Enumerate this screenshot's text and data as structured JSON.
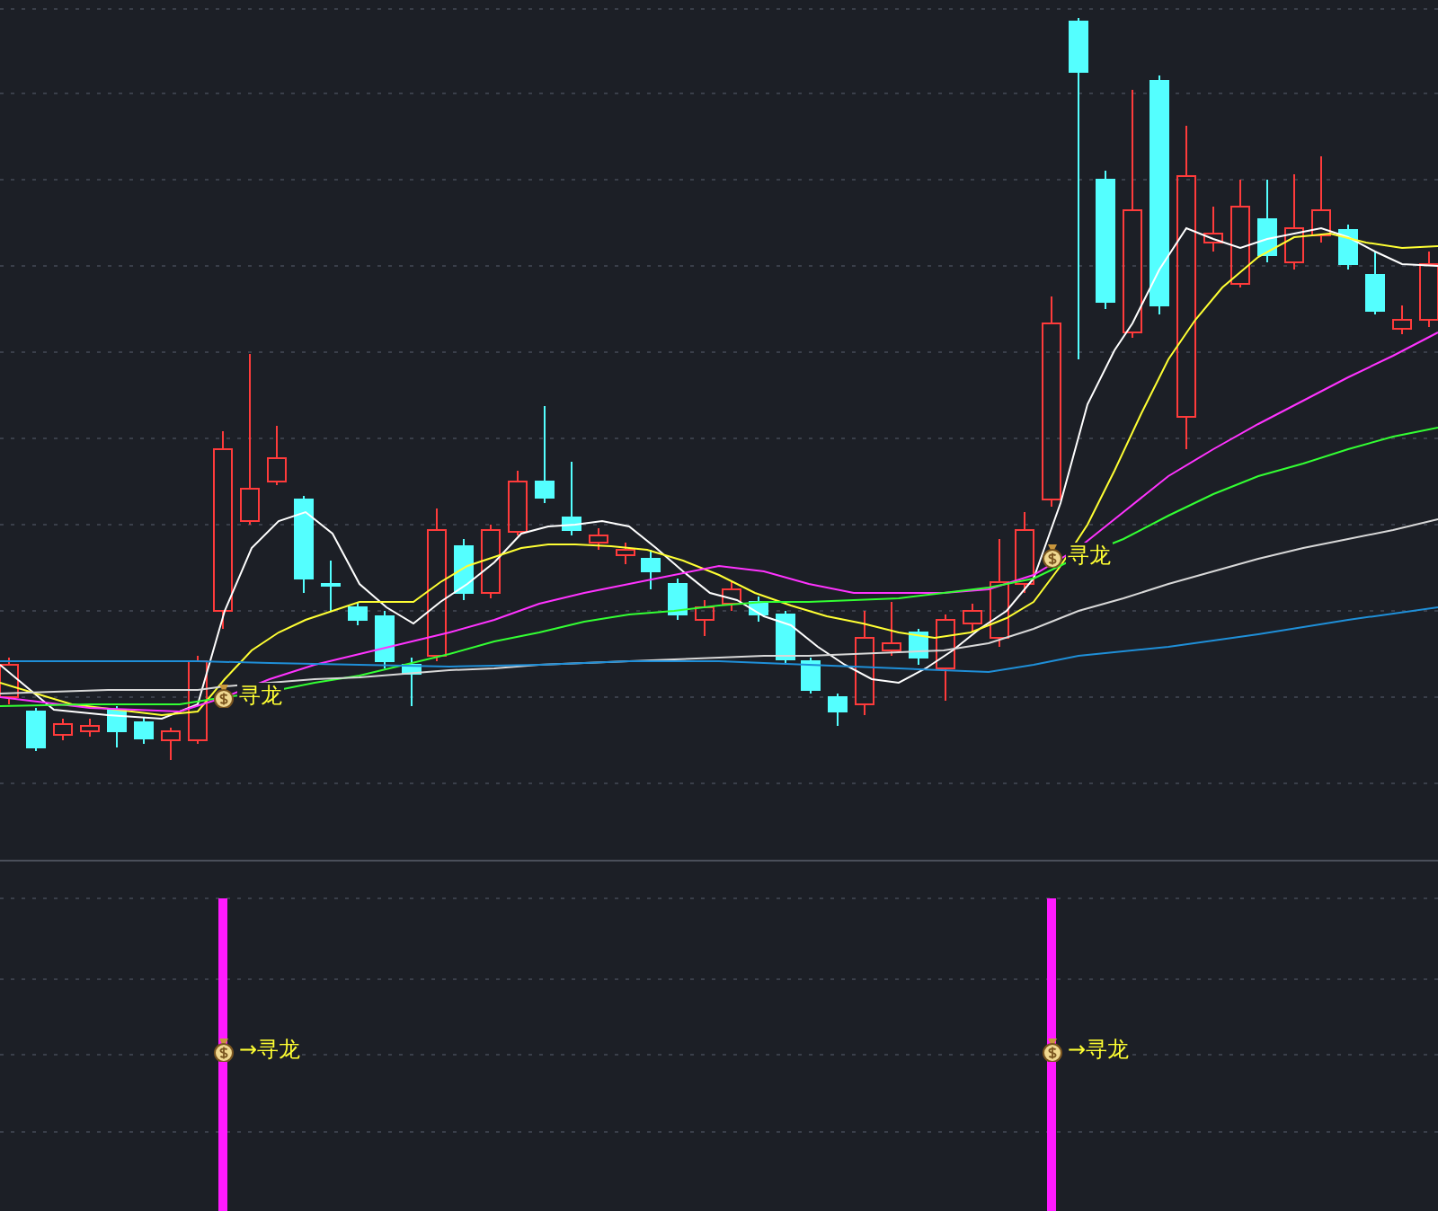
{
  "main_panel": {
    "signals": [
      {
        "label": "寻龙"
      },
      {
        "label": "寻龙"
      }
    ]
  },
  "indicator_panel": {
    "signals": [
      {
        "label": "→寻龙"
      },
      {
        "label": "→寻龙"
      }
    ]
  }
}
